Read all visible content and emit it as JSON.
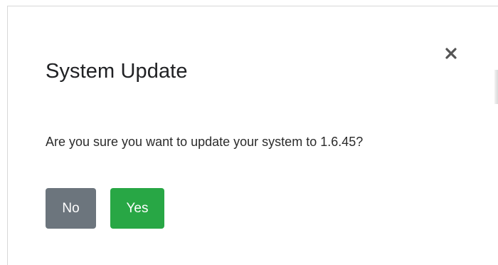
{
  "dialog": {
    "title": "System Update",
    "message": "Are you sure you want to update your system to 1.6.45?",
    "close_icon": "close-icon",
    "buttons": {
      "no_label": "No",
      "yes_label": "Yes"
    }
  },
  "colors": {
    "title_text": "#202124",
    "message_text": "#2b2b2b",
    "no_button": "#6c757d",
    "yes_button": "#28a745",
    "close_icon": "#555555",
    "dialog_border": "#d8d8d8"
  }
}
